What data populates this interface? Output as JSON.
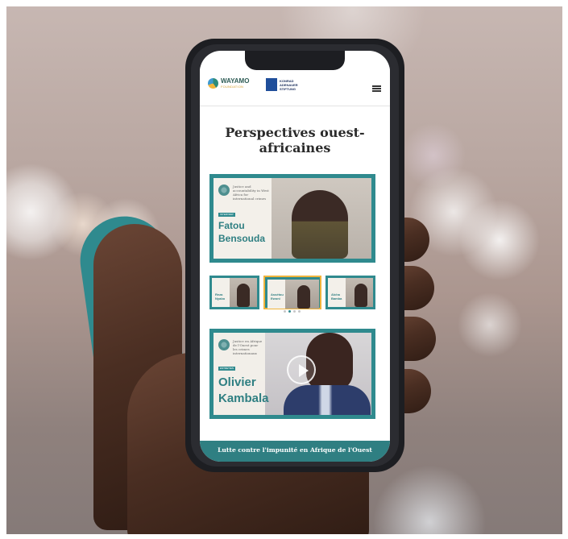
{
  "header": {
    "logo_wayamo": "WAYAMO",
    "logo_wayamo_sub": "FOUNDATION",
    "logo_kas_lines": [
      "KONRAD",
      "ADENAUER",
      "STIFTUNG"
    ]
  },
  "page": {
    "title": "Perspectives ouest-africaines"
  },
  "featured": {
    "description": "Justice and accountability in West Africa for international crimes",
    "tag": "INTERVIEW",
    "speaker_first": "Fatou",
    "speaker_last": "Bensouda"
  },
  "thumbnails": [
    {
      "name_lines": [
        "Reza",
        "Nyabo"
      ]
    },
    {
      "name_lines": [
        "Assétou",
        "Ewoni"
      ]
    },
    {
      "name_lines": [
        "Aïcha",
        "Bamba"
      ]
    }
  ],
  "video": {
    "description": "Justice en Afrique de l'Ouest pour les crimes internationaux",
    "tag": "ENTRETIEN",
    "speaker_first": "Olivier",
    "speaker_last": "Kambala"
  },
  "footer": {
    "text": "Lutte contre l'impunité en Afrique de l'Ouest"
  },
  "colors": {
    "accent_teal": "#2f8a8e",
    "footer_teal": "#2f7f82",
    "highlight_gold": "#f0b43c"
  }
}
